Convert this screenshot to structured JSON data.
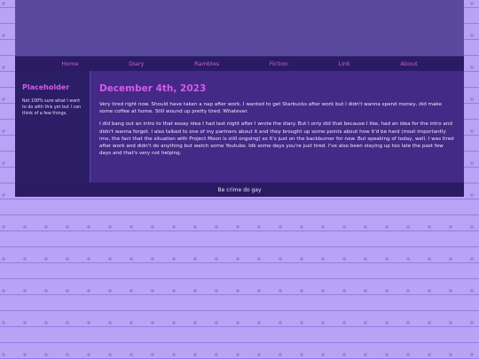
{
  "nav": {
    "items": [
      {
        "label": "Home"
      },
      {
        "label": "Diary"
      },
      {
        "label": "Rambles"
      },
      {
        "label": "Fiction"
      },
      {
        "label": "Link"
      },
      {
        "label": "About"
      }
    ]
  },
  "sidebar": {
    "title": "Placeholder",
    "text": "Not 100% sure what I want to do with this yet but I can think of a few things."
  },
  "post": {
    "date": "December 4th, 2023",
    "paragraphs": [
      "Very tired right now. Should have taken a nap after work. I wanted to get Starbucks after work but I didn't wanna spend money, did make some coffee at home. Still wound up pretty tired. Whatever.",
      "I did bang out an intro to that essay idea I had last night after I wrote the diary. But I only did that because I like, had an idea for the intro and didn't wanna forget. I also talked to one of my partners about it and they brought up some points about how it'd be hard (most importantly imo, the fact that the situation with Project Moon is still ongoing) so it's just on the backburner for now. But speaking of today, well. I was tired after work and didn't do anything but watch some Youtube. Idk some days you're just tired. I've also been staying up too late the past few days and that's very not helping."
    ]
  },
  "footer": {
    "text": "Be crime do gay"
  }
}
